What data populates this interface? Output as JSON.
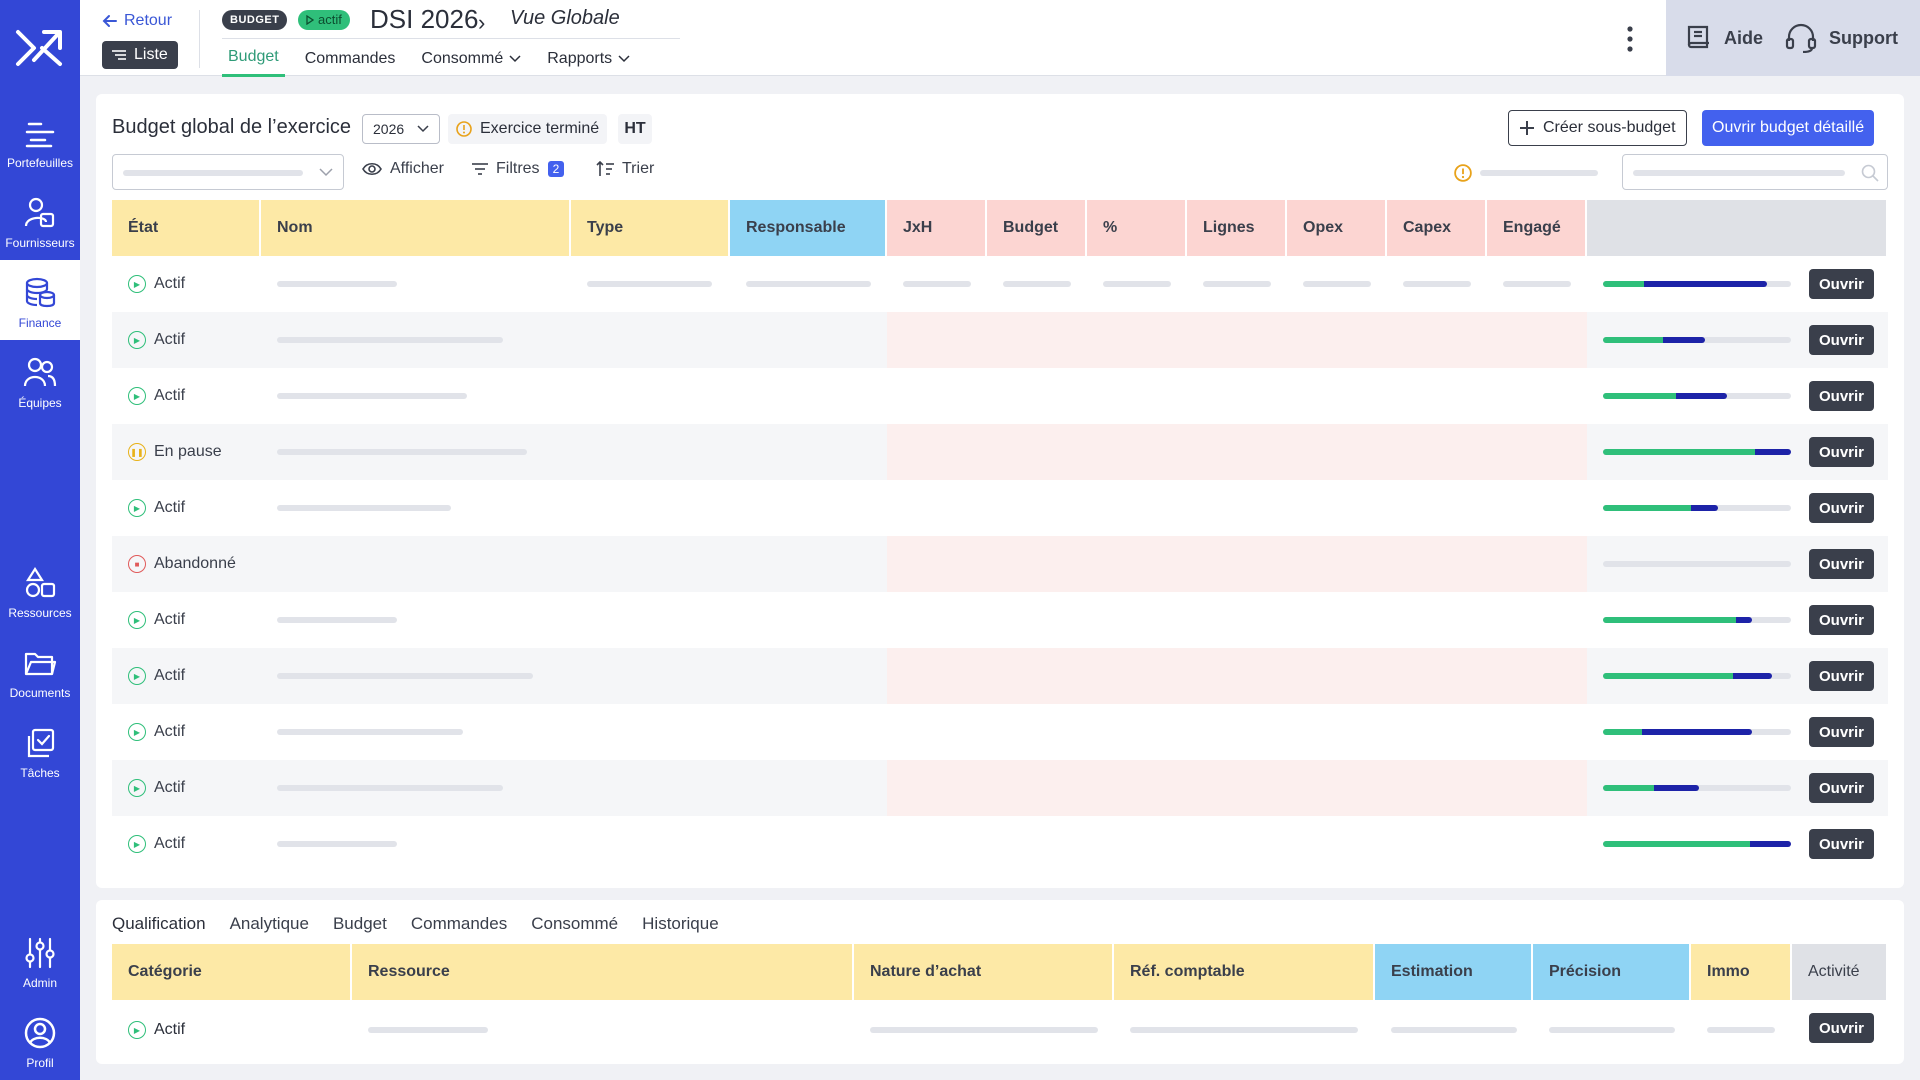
{
  "nav": {
    "items": [
      {
        "label": "Portefeuilles",
        "icon": "portfolio-icon"
      },
      {
        "label": "Fournisseurs",
        "icon": "suppliers-icon"
      },
      {
        "label": "Finance",
        "icon": "finance-icon"
      },
      {
        "label": "Équipes",
        "icon": "teams-icon"
      },
      {
        "label": "Ressources",
        "icon": "resources-icon"
      },
      {
        "label": "Documents",
        "icon": "documents-icon"
      },
      {
        "label": "Tâches",
        "icon": "tasks-icon"
      },
      {
        "label": "Admin",
        "icon": "admin-icon"
      },
      {
        "label": "Profil",
        "icon": "profile-icon"
      }
    ],
    "active": "Finance"
  },
  "header": {
    "back": "Retour",
    "list": "Liste",
    "badge": "BUDGET",
    "status": "actif",
    "title": "DSI 2026",
    "subtitle": "Vue Globale",
    "tabs": [
      "Budget",
      "Commandes",
      "Consommé",
      "Rapports"
    ],
    "active_tab": "Budget",
    "help": "Aide",
    "support": "Support"
  },
  "budget": {
    "title": "Budget global de l’exercice",
    "year": "2026",
    "status": "Exercice terminé",
    "tax": "HT",
    "create_sub": "Créer sous-budget",
    "open_detail": "Ouvrir budget détaillé",
    "toolbar": {
      "show": "Afficher",
      "filters": "Filtres",
      "filters_count": "2",
      "sort": "Trier"
    },
    "columns": [
      "État",
      "Nom",
      "Type",
      "Responsable",
      "JxH",
      "Budget",
      "%",
      "Lignes",
      "Opex",
      "Capex",
      "Engagé"
    ],
    "open_label": "Ouvrir",
    "rows": [
      {
        "state": "Actif",
        "kind": "active",
        "green": 0.22,
        "blue": 0.65
      },
      {
        "state": "Actif",
        "kind": "active",
        "green": 0.32,
        "blue": 0.22
      },
      {
        "state": "Actif",
        "kind": "active",
        "green": 0.39,
        "blue": 0.27
      },
      {
        "state": "En pause",
        "kind": "paused",
        "green": 0.81,
        "blue": 0.19
      },
      {
        "state": "Actif",
        "kind": "active",
        "green": 0.47,
        "blue": 0.14
      },
      {
        "state": "Abandonné",
        "kind": "abandoned",
        "green": 0,
        "blue": 0
      },
      {
        "state": "Actif",
        "kind": "active",
        "green": 0.71,
        "blue": 0.08
      },
      {
        "state": "Actif",
        "kind": "active",
        "green": 0.69,
        "blue": 0.21
      },
      {
        "state": "Actif",
        "kind": "active",
        "green": 0.21,
        "blue": 0.58
      },
      {
        "state": "Actif",
        "kind": "active",
        "green": 0.27,
        "blue": 0.24
      },
      {
        "state": "Actif",
        "kind": "active",
        "green": 0.78,
        "blue": 0.22
      }
    ]
  },
  "detail": {
    "tabs": [
      "Qualification",
      "Analytique",
      "Budget",
      "Commandes",
      "Consommé",
      "Historique"
    ],
    "active_tab": "Qualification",
    "columns": [
      "Catégorie",
      "Ressource",
      "Nature d’achat",
      "Réf. comptable",
      "Estimation",
      "Précision",
      "Immo",
      "Activité"
    ],
    "row": {
      "state": "Actif"
    },
    "open_label": "Ouvrir"
  },
  "colors": {
    "sidebar": "#3347d6",
    "accent": "#4361ee",
    "active_tab": "#2fbf7a",
    "progress_green": "#2fbf7a",
    "progress_blue": "#1d23a8"
  }
}
